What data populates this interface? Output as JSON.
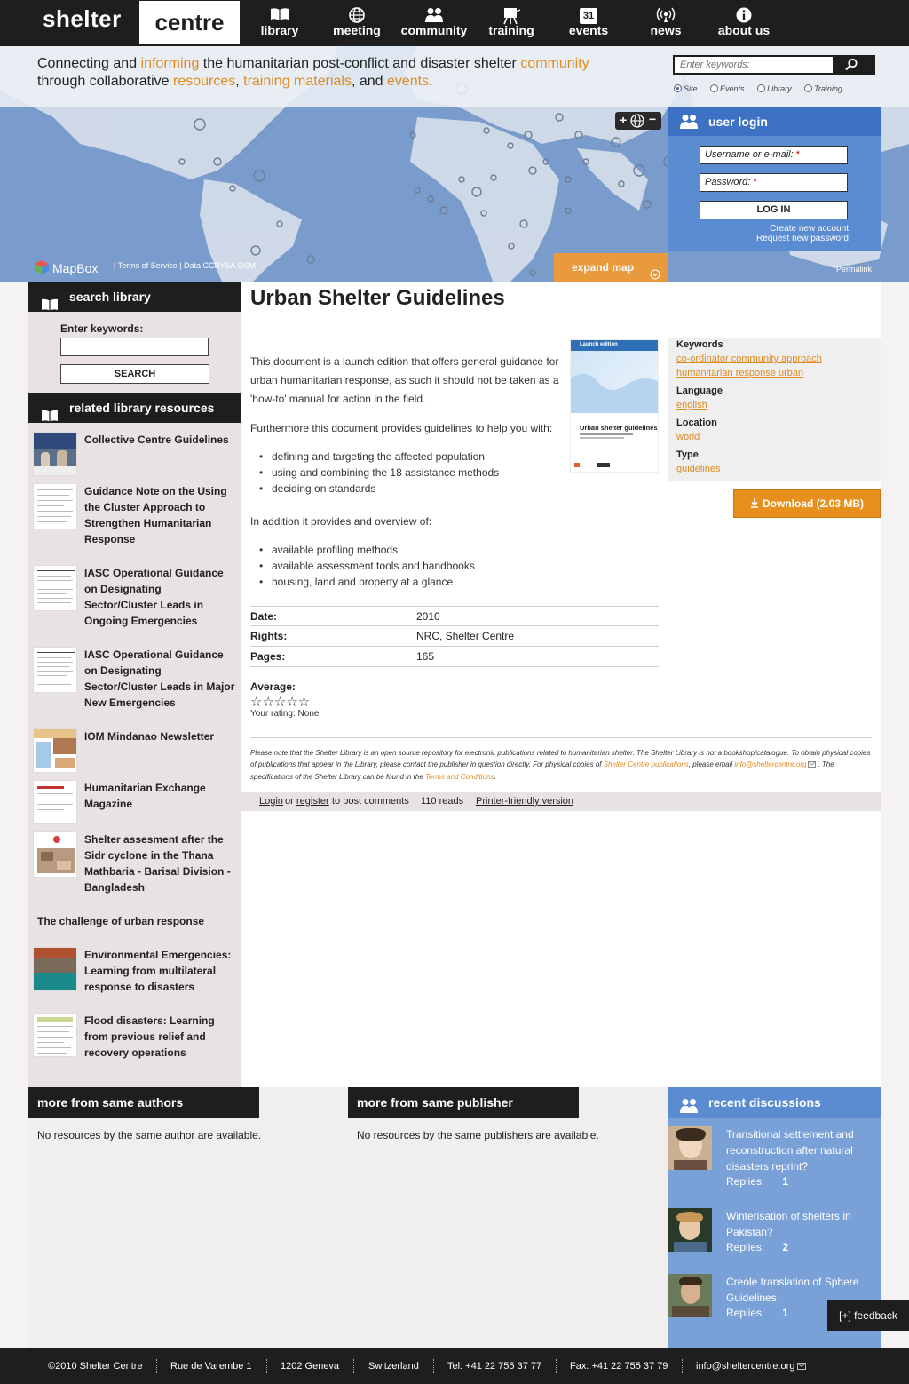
{
  "header": {
    "logo_part1": "shelter",
    "logo_part2": "centre",
    "nav": [
      {
        "label": "library",
        "icon": "book-icon"
      },
      {
        "label": "meeting",
        "icon": "globe-icon"
      },
      {
        "label": "community",
        "icon": "people-icon"
      },
      {
        "label": "training",
        "icon": "easel-icon"
      },
      {
        "label": "events",
        "icon": "calendar-icon"
      },
      {
        "label": "news",
        "icon": "broadcast-icon"
      },
      {
        "label": "about us",
        "icon": "info-icon"
      }
    ],
    "calendar_day": "31"
  },
  "tagline": {
    "t1": "Connecting and ",
    "h1": "informing",
    "t2": " the humanitarian post-conflict and disaster shelter ",
    "h2": "community",
    "t3": "through collaborative ",
    "h3": "resources",
    "t4": ", ",
    "h4": "training materials",
    "t5": ", and ",
    "h5": "events",
    "t6": "."
  },
  "search": {
    "placeholder": "Enter keywords:",
    "options": [
      "Site",
      "Events",
      "Library",
      "Training"
    ],
    "selected": "Site"
  },
  "login": {
    "title": "user login",
    "username_label": "Username or e-mail:",
    "password_label": "Password:",
    "required_mark": "*",
    "button": "LOG IN",
    "create_account": "Create new account",
    "request_password": "Request new password"
  },
  "map": {
    "zoom_in": "+",
    "zoom_out": "−",
    "brand": "MapBox",
    "credits": "| Terms of Service | Data CCBYSA OSM",
    "expand": "expand map",
    "permalink": "Permalink"
  },
  "sidebar": {
    "search_title": "search library",
    "keywords_label": "Enter keywords:",
    "search_button": "SEARCH",
    "related_title": "related library resources",
    "related": [
      {
        "title": "Collective Centre Guidelines"
      },
      {
        "title": "Guidance Note on the Using the Cluster Approach to Strengthen Humanitarian Response"
      },
      {
        "title": "IASC Operational Guidance on Designating Sector/Cluster Leads in Ongoing Emergencies"
      },
      {
        "title": "IASC Operational Guidance on Designating Sector/Cluster Leads in Major New Emergencies"
      },
      {
        "title": "IOM Mindanao Newsletter"
      },
      {
        "title": "Humanitarian Exchange Magazine"
      },
      {
        "title": "Shelter assesment after the Sidr cyclone in the Thana Mathbaria - Barisal Division - Bangladesh"
      },
      {
        "title": "The challenge of urban response"
      },
      {
        "title": "Environmental Emergencies: Learning from multilateral response to disasters"
      },
      {
        "title": "Flood disasters: Learning from previous relief and recovery operations"
      }
    ]
  },
  "document": {
    "title": "Urban Shelter Guidelines",
    "intro": "This document is a launch edition that offers general guidance for urban humanitarian response, as such it should not be taken as a 'how-to' manual for action in the field.",
    "furthermore": "Furthermore this document provides guidelines to help you with:",
    "bullets1": [
      "defining and targeting the affected population",
      "using and combining the 18 assistance methods",
      "deciding on standards"
    ],
    "addition": "In addition it provides and overview of:",
    "bullets2": [
      "available profiling methods",
      "available assessment tools and handbooks",
      "housing, land and property at a glance"
    ],
    "cover_edition": "Launch edition",
    "cover_title": "Urban shelter guidelines",
    "info": [
      {
        "key": "Date:",
        "value": "2010"
      },
      {
        "key": "Rights:",
        "value": "NRC, Shelter Centre"
      },
      {
        "key": "Pages:",
        "value": "165"
      }
    ],
    "average_label": "Average:",
    "stars": "☆☆☆☆☆",
    "rating_out_of": 5,
    "your_rating": "Your rating: None",
    "download": "Download (2.03 MB)"
  },
  "metadata": {
    "keywords_label": "Keywords",
    "keywords": [
      "co-ordinator",
      "community approach",
      "humanitarian response",
      "urban"
    ],
    "language_label": "Language",
    "language": "english",
    "location_label": "Location",
    "location": "world",
    "type_label": "Type",
    "type": "guidelines"
  },
  "note": {
    "t1": "Please note that the Shelter Library is an open source repository for electronic publications related to humanitarian shelter. The Shelter Library is not a bookshop/catalogue. To obtain physical copies of publications that appear in the Library, please contact the publisher in question directly. For physical copies of ",
    "l1": "Shelter Centre publications",
    "t2": ", please email ",
    "l2": "info@sheltercentre.org",
    "t3": ". The specifications of the Shelter Library can be found in the ",
    "l3": "Terms and Conditions",
    "t4": "."
  },
  "links": {
    "login": "Login",
    "or": "or",
    "register": "register",
    "post": "to post comments",
    "reads": "110 reads",
    "printer": "Printer-friendly version"
  },
  "bottom": {
    "authors_title": "more from same authors",
    "authors_text": "No resources by the same author are available.",
    "publisher_title": "more from same publisher",
    "publisher_text": "No resources by the same publishers are available.",
    "discussions_title": "recent discussions",
    "replies_label": "Replies:",
    "discussions": [
      {
        "title": "Transitional settlement and reconstruction after natural disasters reprint?",
        "replies": "1"
      },
      {
        "title": "Winterisation of shelters in Pakistan?",
        "replies": "2"
      },
      {
        "title": "Creole translation of Sphere Guidelines",
        "replies": "1"
      }
    ]
  },
  "feedback": "[+] feedback",
  "footer": {
    "copyright": "©2010 Shelter Centre",
    "street": "Rue de Varembe 1",
    "city": "1202 Geneva",
    "country": "Switzerland",
    "tel": "Tel: +41 22 755 37 77",
    "fax": "Fax: +41 22 755 37 79",
    "email": "info@sheltercentre.org"
  },
  "colors": {
    "accent_orange": "#e08a1e",
    "header_dark": "#1e1e1e",
    "login_blue": "#5b8bd0",
    "map_blue": "#7a9ccc"
  }
}
